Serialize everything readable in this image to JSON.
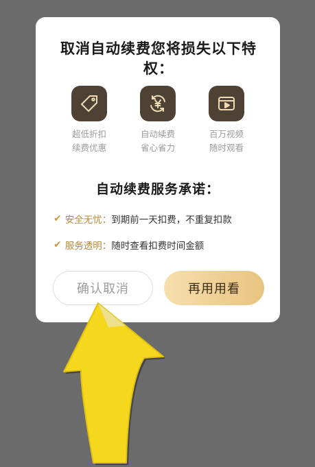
{
  "dialog": {
    "title": "取消自动续费您将损失以下特权：",
    "perks": [
      {
        "icon": "price-tag-icon",
        "label": "超低折扣\n续费优惠"
      },
      {
        "icon": "yuan-refresh-icon",
        "label": "自动续费\n省心省力"
      },
      {
        "icon": "video-play-icon",
        "label": "百万视频\n随时观看"
      }
    ],
    "promise_title": "自动续费服务承诺：",
    "promises": [
      {
        "key": "安全无忧：",
        "text": "到期前一天扣费，不重复扣款"
      },
      {
        "key": "服务透明：",
        "text": "随时查看扣费时间金额"
      }
    ],
    "buttons": {
      "confirm_cancel": "确认取消",
      "keep_using": "再用用看"
    }
  },
  "colors": {
    "overlay": "#6b6b6b",
    "icon_bg": "#4d4233",
    "accent_gold": "#c89b3f",
    "arrow": "#f5d81d"
  }
}
